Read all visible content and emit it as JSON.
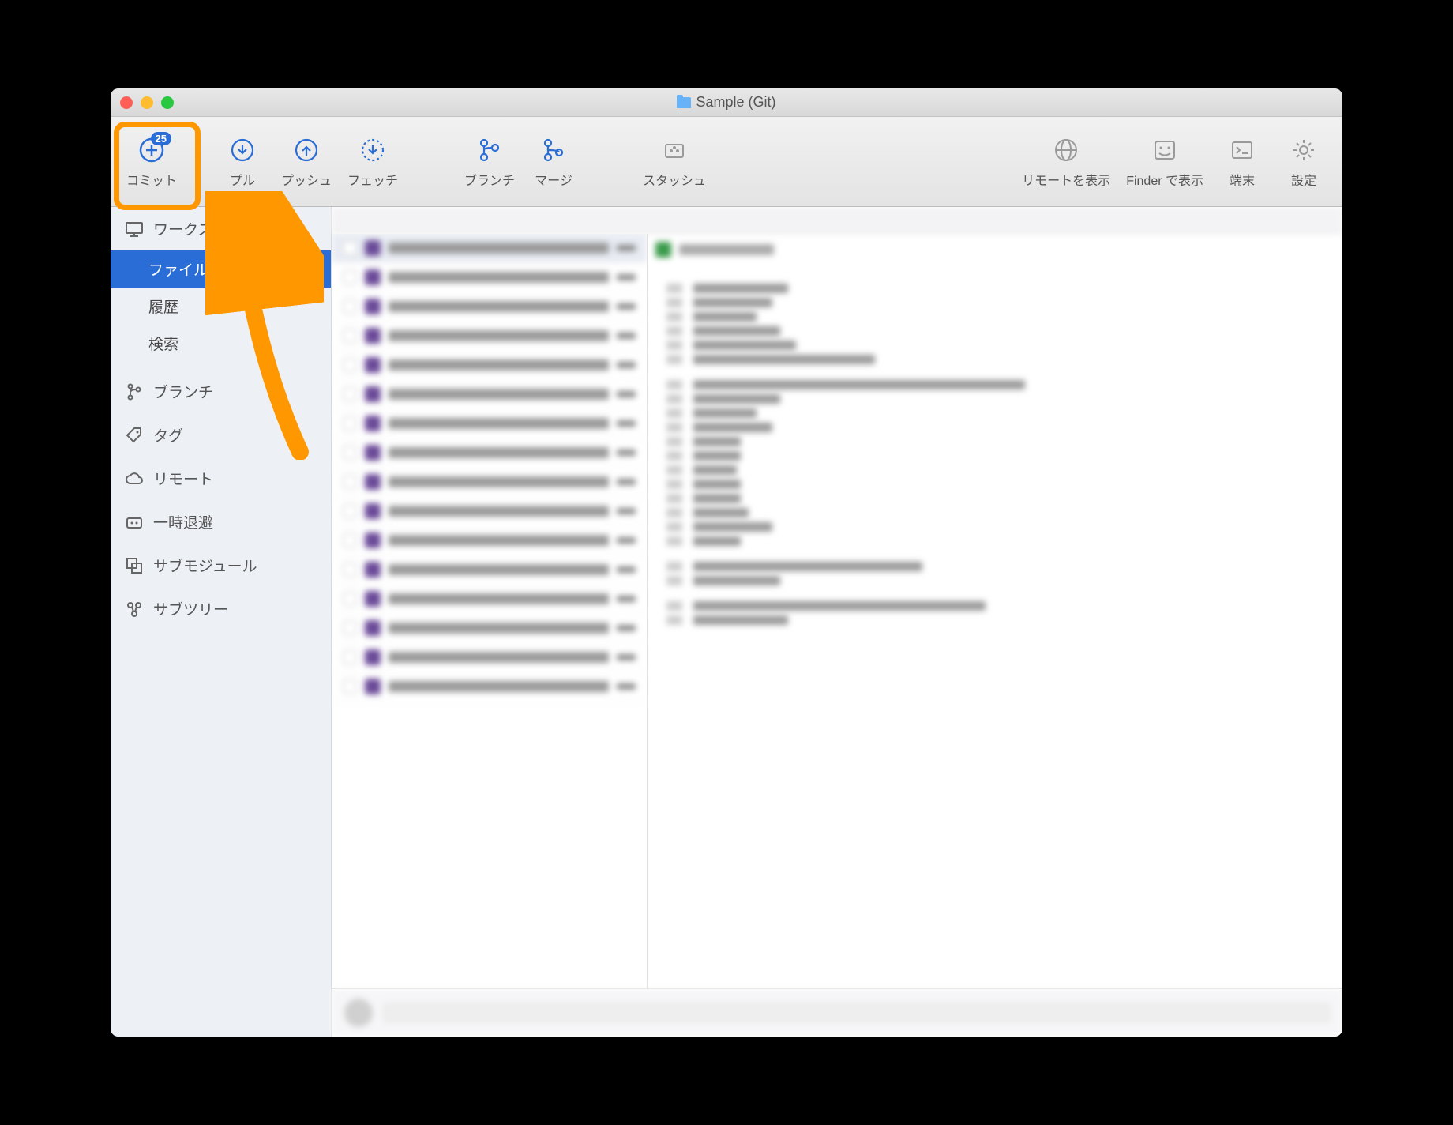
{
  "window": {
    "title": "Sample (Git)"
  },
  "toolbar": {
    "commit": {
      "label": "コミット",
      "badge": "25"
    },
    "pull": "プル",
    "push": "プッシュ",
    "fetch": "フェッチ",
    "branch": "ブランチ",
    "merge": "マージ",
    "stash": "スタッシュ",
    "show_remote": "リモートを表示",
    "show_finder": "Finder で表示",
    "terminal": "端末",
    "settings": "設定"
  },
  "sidebar": {
    "workspace": "ワークスペース",
    "items": {
      "file_status": "ファイルステ…",
      "history": "履歴",
      "search": "検索"
    },
    "branches": "ブランチ",
    "tags": "タグ",
    "remotes": "リモート",
    "stashes": "一時退避",
    "submodules": "サブモジュール",
    "subtrees": "サブツリー"
  },
  "annotation": {
    "highlight_target": "commit-button",
    "arrow_from": "workspace-section"
  }
}
